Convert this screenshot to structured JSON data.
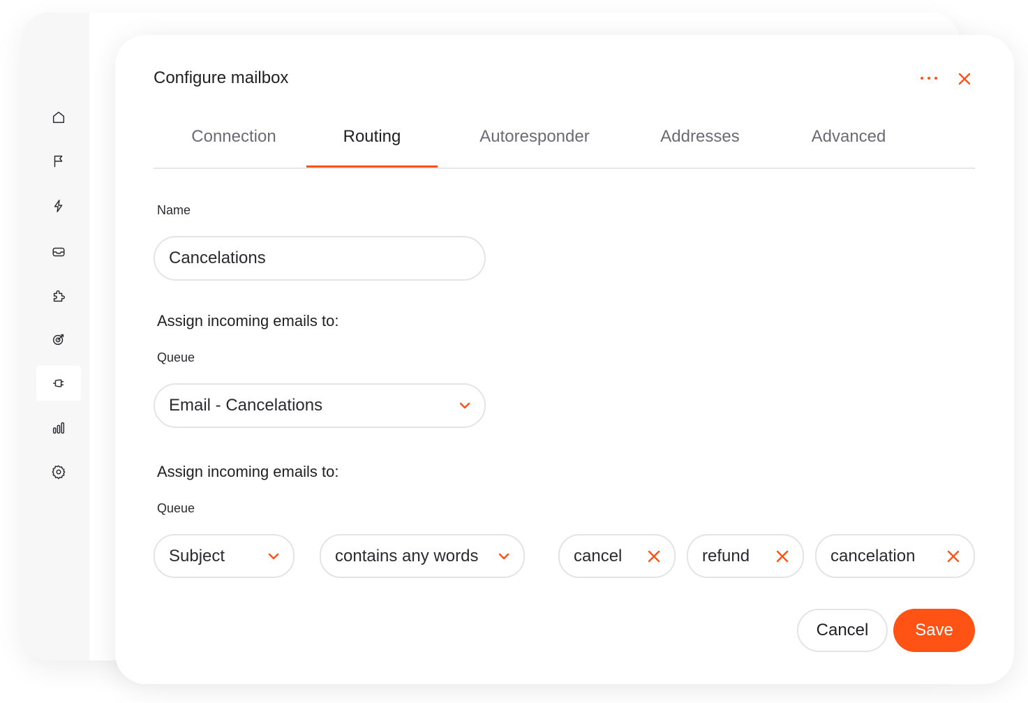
{
  "modal": {
    "title": "Configure mailbox",
    "accent_color": "#ff5215"
  },
  "sidebar": {
    "items": [
      {
        "icon": "home-icon",
        "active": false
      },
      {
        "icon": "flag-icon",
        "active": false
      },
      {
        "icon": "lightning-icon",
        "active": false
      },
      {
        "icon": "inbox-icon",
        "active": false
      },
      {
        "icon": "puzzle-icon",
        "active": false
      },
      {
        "icon": "target-icon",
        "active": false
      },
      {
        "icon": "plug-icon",
        "active": true
      },
      {
        "icon": "bar-chart-icon",
        "active": false
      },
      {
        "icon": "settings-icon",
        "active": false
      }
    ]
  },
  "tabs": [
    {
      "label": "Connection"
    },
    {
      "label": "Routing",
      "active": true
    },
    {
      "label": "Autoresponder"
    },
    {
      "label": "Addresses"
    },
    {
      "label": "Advanced"
    }
  ],
  "form": {
    "name_label": "Name",
    "name_value": "Cancelations",
    "assign_title_1": "Assign incoming emails to:",
    "queue_label_1": "Queue",
    "queue_value": "Email - Cancelations",
    "assign_title_2": "Assign incoming emails to:",
    "queue_label_2": "Queue",
    "rule_field": "Subject",
    "rule_operator": "contains any words",
    "keywords": [
      "cancel",
      "refund",
      "cancelation"
    ]
  },
  "actions": {
    "cancel_label": "Cancel",
    "save_label": "Save"
  }
}
